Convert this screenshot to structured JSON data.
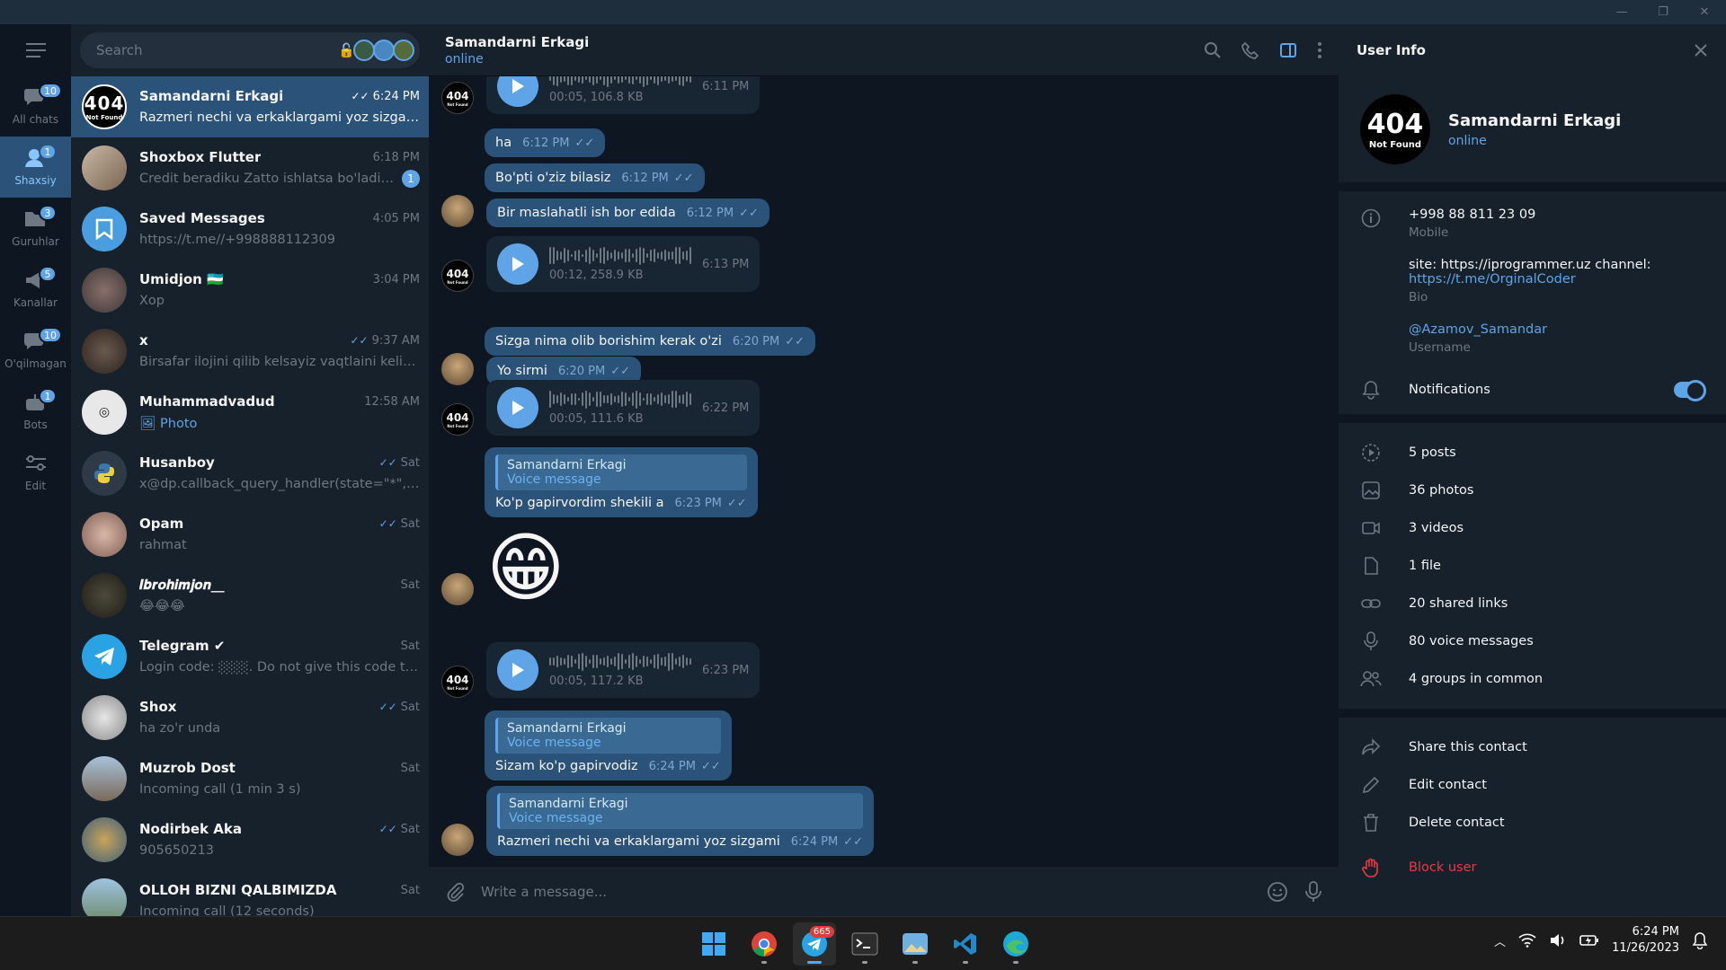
{
  "window": {
    "minimize": "—",
    "restore": "❐",
    "close": "✕"
  },
  "folders": [
    {
      "label": "All chats",
      "badge": "10",
      "active": false
    },
    {
      "label": "Shaxsiy",
      "badge": "1",
      "active": true
    },
    {
      "label": "Guruhlar",
      "badge": "3",
      "active": false
    },
    {
      "label": "Kanallar",
      "badge": "5",
      "active": false
    },
    {
      "label": "O'qilmagan",
      "badge": "10",
      "active": false
    },
    {
      "label": "Bots",
      "badge": "1",
      "active": false
    },
    {
      "label": "Edit",
      "badge": "",
      "active": false
    }
  ],
  "search": {
    "placeholder": "Search"
  },
  "chats": [
    {
      "name": "Samandarni Erkagi",
      "time": "6:24 PM",
      "msg": "Razmeri nechi va erkaklargami yoz sizgami",
      "check": "✓✓",
      "unread": "",
      "active": true
    },
    {
      "name": "Shoxbox Flutter",
      "time": "6:18 PM",
      "msg": "Credit beradiku Zatto ishlatsa bo'ladi an...",
      "check": "",
      "unread": "1"
    },
    {
      "name": "Saved Messages",
      "time": "4:05 PM",
      "msg": "https://t.me//+998888112309",
      "check": "",
      "unread": ""
    },
    {
      "name": "Umidjon 🇺🇿",
      "time": "3:04 PM",
      "msg": "Xop",
      "check": "",
      "unread": ""
    },
    {
      "name": "x",
      "time": "9:37 AM",
      "msg": "Birsafar ilojini qilib kelsayiz vaqtlaini kelishi...",
      "check": "✓✓",
      "unread": ""
    },
    {
      "name": "Muhammadvadud",
      "time": "12:58 AM",
      "msg": "🖼 Photo",
      "check": "",
      "unread": ""
    },
    {
      "name": "Husanboy",
      "time": "Sat",
      "msg": "x@dp.callback_query_handler(state=\"*\", text...",
      "check": "✓✓",
      "unread": ""
    },
    {
      "name": "Opam",
      "time": "Sat",
      "msg": "rahmat",
      "check": "✓✓",
      "unread": ""
    },
    {
      "name": "𝑰𝒃𝒓𝒐𝒉𝒊𝒎𝒋𝒐𝒏__",
      "time": "Sat",
      "msg": "😂😂😂",
      "check": "",
      "unread": ""
    },
    {
      "name": "Telegram ✔",
      "time": "Sat",
      "msg": "Login code: ░░░. Do not give this code to a...",
      "check": "",
      "unread": ""
    },
    {
      "name": "Shox",
      "time": "Sat",
      "msg": "ha zo'r unda",
      "check": "✓✓",
      "unread": ""
    },
    {
      "name": "Muzrob Dost",
      "time": "Sat",
      "msg": "Incoming call (1 min 3 s)",
      "check": "",
      "unread": ""
    },
    {
      "name": "Nodirbek Aka",
      "time": "Sat",
      "msg": "905650213",
      "check": "✓✓",
      "unread": ""
    },
    {
      "name": "OLLOH BIZNI QALBIMIZDA",
      "time": "Sat",
      "msg": "Incoming call (12 seconds)",
      "check": "",
      "unread": ""
    }
  ],
  "header": {
    "title": "Samandarni Erkagi",
    "status": "online"
  },
  "messages": {
    "v1": {
      "meta": "00:05, 106.8 KB",
      "time": "6:11 PM"
    },
    "m1": {
      "text": "ha",
      "time": "6:12 PM"
    },
    "m2": {
      "text": "Bo'pti o'ziz bilasiz",
      "time": "6:12 PM"
    },
    "m3": {
      "text": "Bir maslahatli ish bor edida",
      "time": "6:12 PM"
    },
    "v2": {
      "meta": "00:12, 258.9 KB",
      "time": "6:13 PM"
    },
    "m4": {
      "text": "Sizga nima olib borishim kerak o'zi",
      "time": "6:20 PM"
    },
    "m5": {
      "text": "Yo sirmi",
      "time": "6:20 PM"
    },
    "v3": {
      "meta": "00:05, 111.6 KB",
      "time": "6:22 PM"
    },
    "r1": {
      "name": "Samandarni Erkagi",
      "sub": "Voice message",
      "text": "Ko'p gapirvordim shekili a",
      "time": "6:23 PM"
    },
    "emoji": "😁",
    "v4": {
      "meta": "00:05, 117.2 KB",
      "time": "6:23 PM"
    },
    "r2": {
      "name": "Samandarni Erkagi",
      "sub": "Voice message",
      "text": "Sizam ko'p gapirvodiz",
      "time": "6:24 PM"
    },
    "r3": {
      "name": "Samandarni Erkagi",
      "sub": "Voice message",
      "text": "Razmeri nechi va erkaklargami yoz sizgami",
      "time": "6:24 PM"
    },
    "check": "✓✓"
  },
  "composer": {
    "placeholder": "Write a message..."
  },
  "info": {
    "title": "User Info",
    "name": "Samandarni Erkagi",
    "status": "online",
    "avatar_text": "404",
    "avatar_sub": "Not Found",
    "phone": "+998 88 811 23 09",
    "phone_label": "Mobile",
    "bio_text": "site: https://iprogrammer.uz channel:",
    "bio_link": "https://t.me/OrginalCoder",
    "bio_label": "Bio",
    "username": "@Azamov_Samandar",
    "username_label": "Username",
    "notifications": "Notifications",
    "media": [
      {
        "icon": "posts-icon",
        "label": "5 posts"
      },
      {
        "icon": "photos-icon",
        "label": "36 photos"
      },
      {
        "icon": "videos-icon",
        "label": "3 videos"
      },
      {
        "icon": "file-icon",
        "label": "1 file"
      },
      {
        "icon": "link-icon",
        "label": "20 shared links"
      },
      {
        "icon": "mic-icon",
        "label": "80 voice messages"
      },
      {
        "icon": "groups-icon",
        "label": "4 groups in common"
      }
    ],
    "share": "Share this contact",
    "edit": "Edit contact",
    "delete": "Delete contact",
    "block": "Block user"
  },
  "taskbar": {
    "telegram_badge": "665",
    "time": "6:24 PM",
    "date": "11/26/2023"
  },
  "colors": {
    "accent": "#5fa4e6",
    "bubble_out": "#2b5278",
    "bubble_in": "#182533",
    "panel": "#17212b",
    "bg": "#0e1621",
    "danger": "#ec3942"
  }
}
